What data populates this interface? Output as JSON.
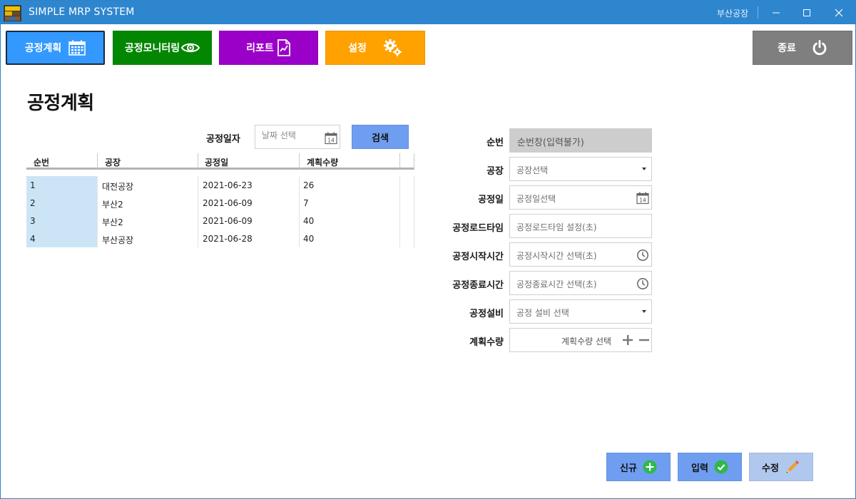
{
  "window": {
    "title": "SIMPLE MRP SYSTEM",
    "factory_label": "부산공장",
    "accent_color": "#2e86cf"
  },
  "nav": {
    "plan": {
      "label": "공정계획",
      "icon": "calendar-icon",
      "color": "#3399ff"
    },
    "monitor": {
      "label": "공정모니터링",
      "icon": "eye-icon",
      "color": "#038703"
    },
    "report": {
      "label": "리포트",
      "icon": "report-icon",
      "color": "#9b00c9"
    },
    "settings": {
      "label": "설정",
      "icon": "gears-icon",
      "color": "#ffa200"
    },
    "exit": {
      "label": "종료",
      "icon": "power-icon",
      "color": "#7f7f7f"
    }
  },
  "page": {
    "title": "공정계획"
  },
  "search": {
    "label": "공정일자",
    "date_placeholder": "날짜 선택",
    "button_label": "검색"
  },
  "grid": {
    "columns": [
      "순번",
      "공장",
      "공정일",
      "계획수량"
    ],
    "rows": [
      {
        "no": "1",
        "plant": "대전공장",
        "date": "2021-06-23",
        "qty": "26"
      },
      {
        "no": "2",
        "plant": "부산2",
        "date": "2021-06-09",
        "qty": "7"
      },
      {
        "no": "3",
        "plant": "부산2",
        "date": "2021-06-09",
        "qty": "40"
      },
      {
        "no": "4",
        "plant": "부산공장",
        "date": "2021-06-28",
        "qty": "40"
      }
    ]
  },
  "form": {
    "seq": {
      "label": "순번",
      "value": "순번창(입력불가)"
    },
    "plant": {
      "label": "공장",
      "placeholder": "공장선택"
    },
    "date": {
      "label": "공정일",
      "placeholder": "공정일선택"
    },
    "lead_time": {
      "label": "공정로드타임",
      "placeholder": "공정로드타임 설정(초)"
    },
    "start_time": {
      "label": "공정시작시간",
      "placeholder": "공정시작시간 선택(초)"
    },
    "end_time": {
      "label": "공정종료시간",
      "placeholder": "공정종료시간 선택(초)"
    },
    "equipment": {
      "label": "공정설비",
      "placeholder": "공정 설비 선택"
    },
    "quantity": {
      "label": "계획수량",
      "placeholder": "계획수량 선택"
    }
  },
  "actions": {
    "new_label": "신규",
    "insert_label": "입력",
    "edit_label": "수정"
  }
}
